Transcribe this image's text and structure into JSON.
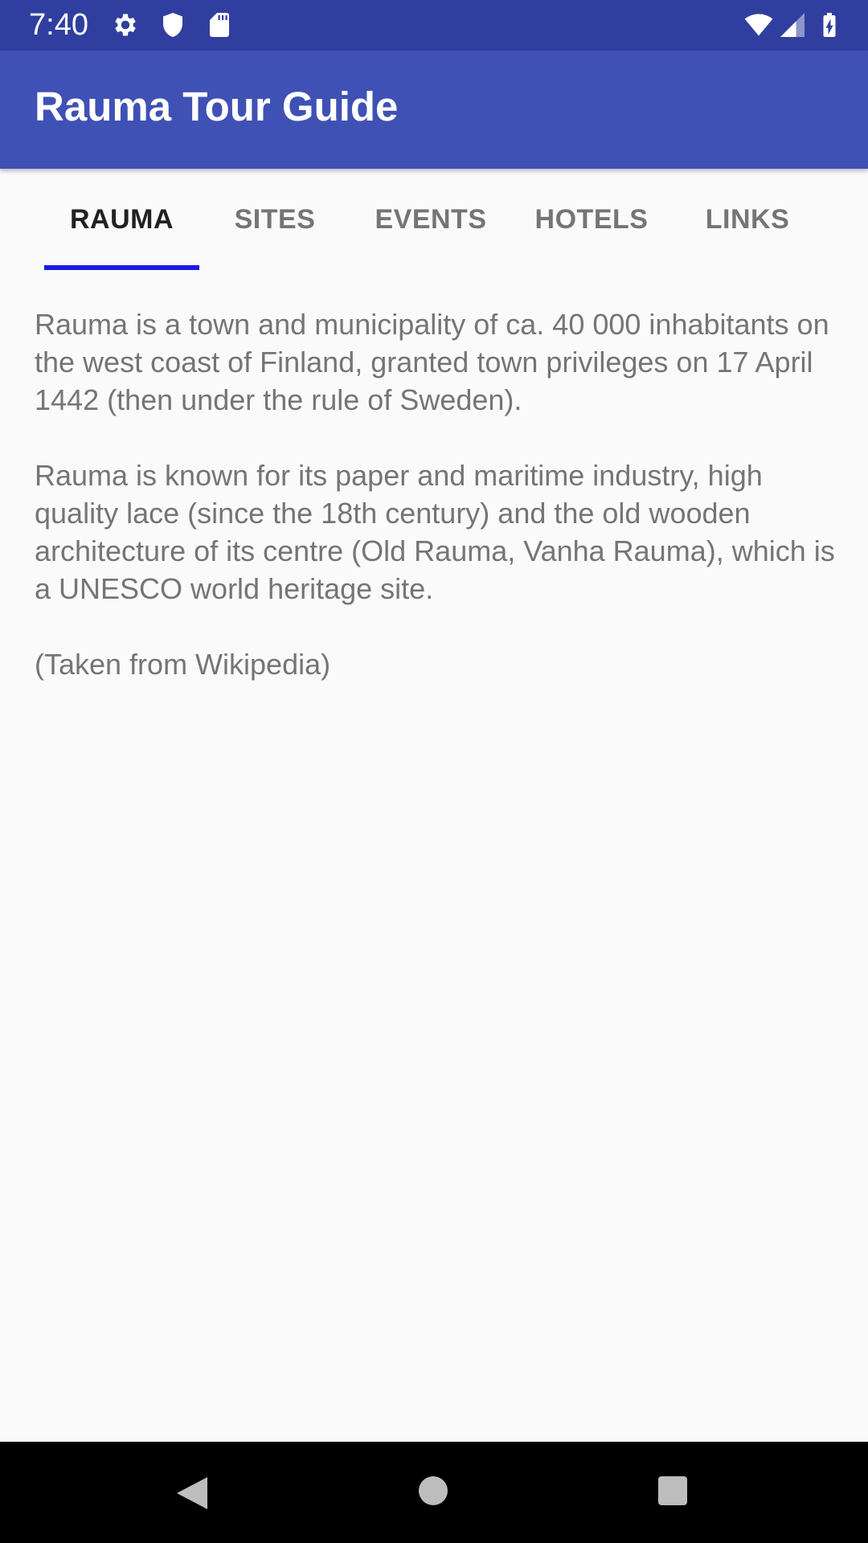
{
  "status_bar": {
    "time": "7:40",
    "left_icons": [
      "gear-icon",
      "shield-icon",
      "sd-card-icon"
    ],
    "right_icons": [
      "wifi-icon",
      "cell-signal-icon",
      "battery-charging-icon"
    ],
    "background": "#303f9f"
  },
  "app_bar": {
    "title": "Rauma Tour Guide",
    "background": "#3f51b5"
  },
  "tabs": [
    {
      "label": "RAUMA",
      "active": true
    },
    {
      "label": "SITES",
      "active": false
    },
    {
      "label": "EVENTS",
      "active": false
    },
    {
      "label": "HOTELS",
      "active": false
    },
    {
      "label": "LINKS",
      "active": false
    }
  ],
  "tab_indicator_color": "#1a1ae6",
  "content": {
    "paragraphs": [
      "Rauma is a town and municipality of ca. 40 000 inhabitants on the west coast of Finland, granted town privileges on 17 April 1442 (then under the rule of Sweden).",
      "Rauma is known for its paper and maritime industry, high quality lace (since the 18th century) and the old wooden architecture of its centre (Old Rauma, Vanha Rauma), which is a UNESCO world heritage site.",
      "(Taken from Wikipedia)"
    ]
  },
  "nav_bar": {
    "buttons": [
      "back-icon",
      "home-icon",
      "recents-icon"
    ]
  }
}
